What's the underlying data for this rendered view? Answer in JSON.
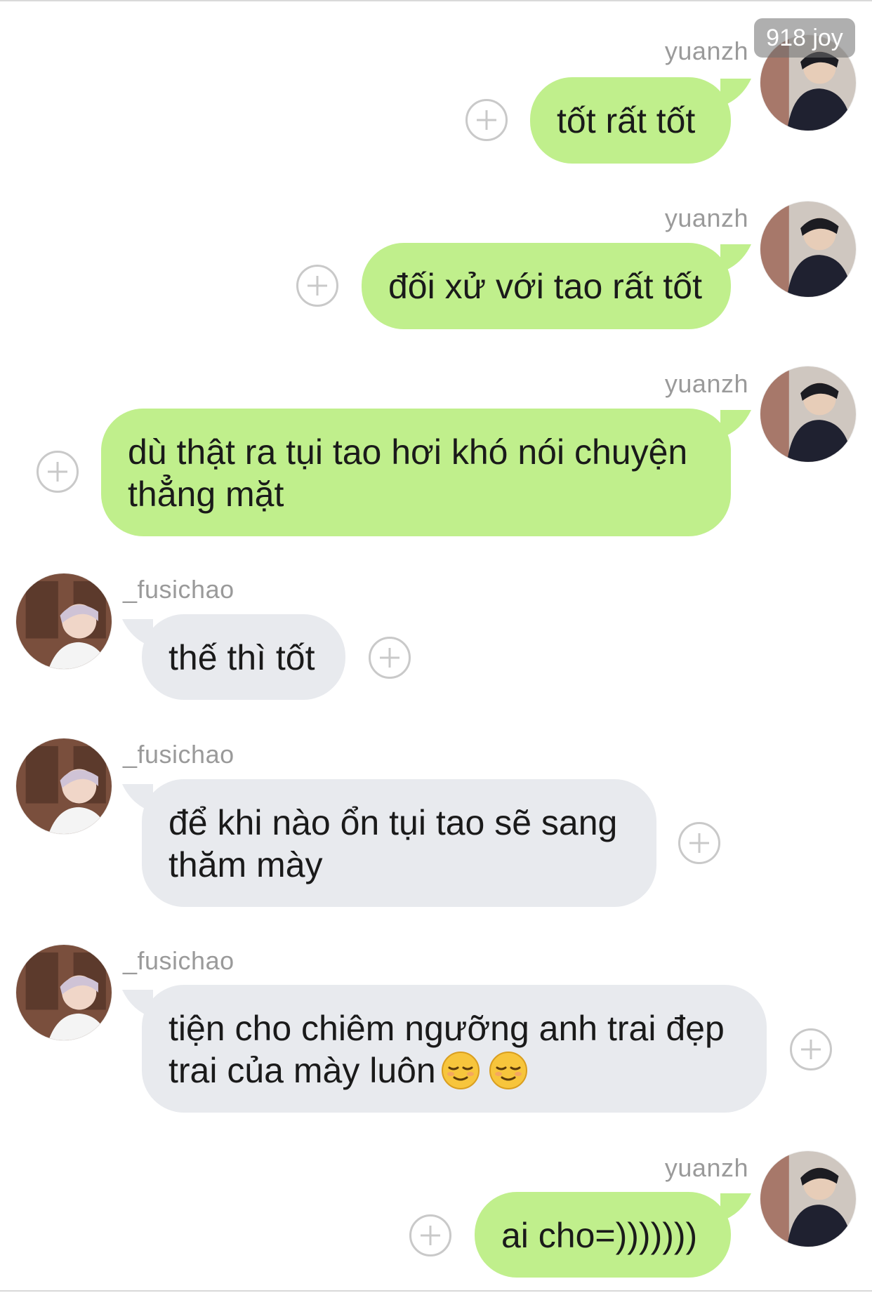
{
  "watermark": "918 joy",
  "contacts": {
    "me": "yuanzh",
    "other": "_fusichao"
  },
  "messages": [
    {
      "sender": "yuanzh",
      "text": "tốt rất tốt"
    },
    {
      "sender": "yuanzh",
      "text": "đối xử với tao rất tốt"
    },
    {
      "sender": "yuanzh",
      "text": "dù thật ra tụi tao hơi khó nói chuyện\nthẳng mặt"
    },
    {
      "sender": "_fusichao",
      "text": "thế thì tốt"
    },
    {
      "sender": "_fusichao",
      "text": "để khi nào ổn tụi tao sẽ sang\nthăm mày"
    },
    {
      "sender": "_fusichao",
      "text": "tiện cho chiêm ngưỡng anh trai đẹp\ntrai của mày luôn",
      "emoji": "relieved-face x2"
    },
    {
      "sender": "yuanzh",
      "text": "ai cho=)))))))"
    }
  ],
  "colors": {
    "my_bubble": "#c0ef8c",
    "their_bubble": "#e8eaee",
    "name_text": "#9a9a9a",
    "plus_icon": "#c9c9c9"
  }
}
